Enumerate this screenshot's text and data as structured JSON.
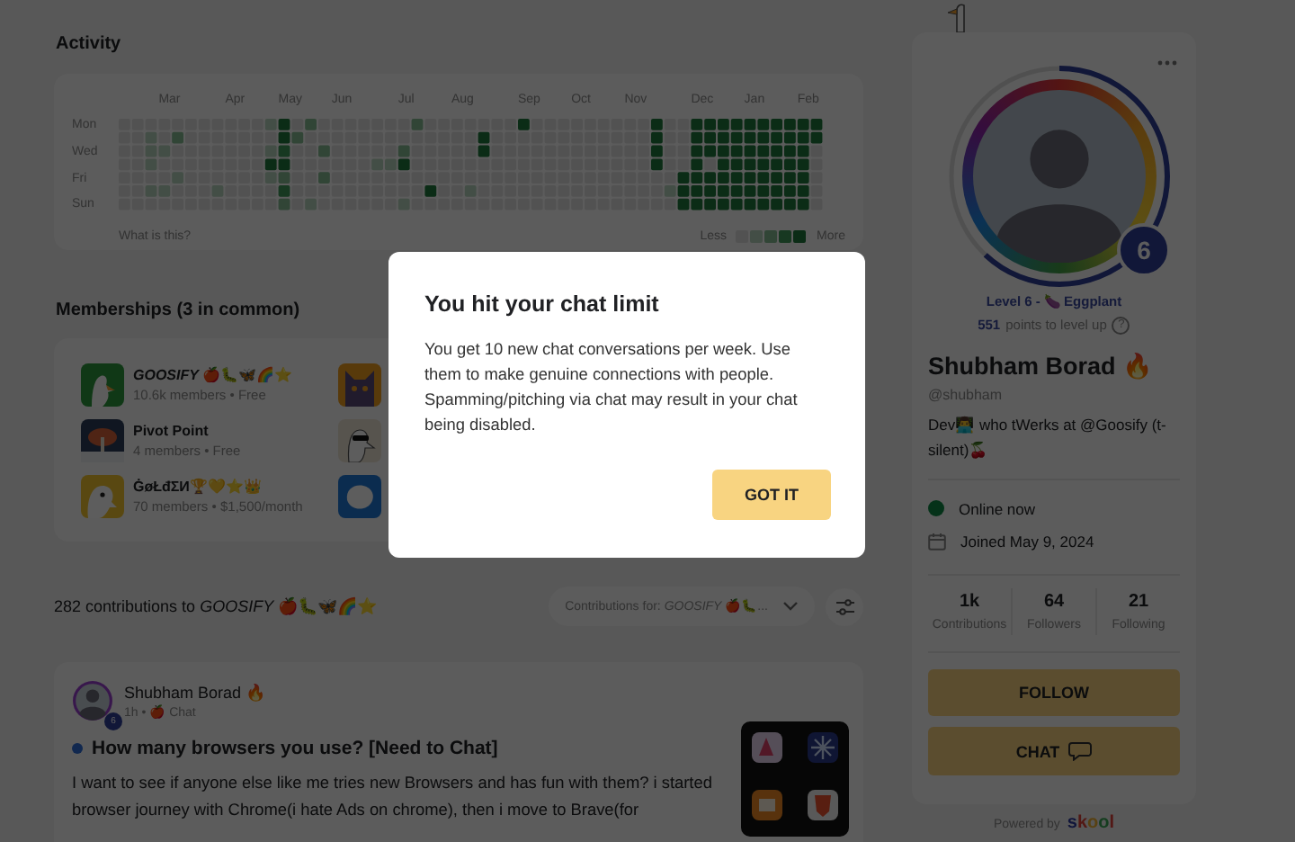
{
  "activity": {
    "title": "Activity",
    "months": [
      "Mar",
      "Apr",
      "May",
      "Jun",
      "Jul",
      "Aug",
      "Sep",
      "Oct",
      "Nov",
      "Dec",
      "Jan",
      "Feb"
    ],
    "day_labels": [
      "Mon",
      "Wed",
      "Fri",
      "Sun"
    ],
    "help_link": "What is this?",
    "legend_less": "Less",
    "legend_more": "More"
  },
  "memberships": {
    "title": "Memberships (3 in common)",
    "items": [
      {
        "name": "*GOOSIFY* 🍎🐛🦋🌈⭐",
        "meta": "10.6k members • Free"
      },
      {
        "name": "Pivot Point",
        "meta": "4 members • Free"
      },
      {
        "name": "ĠøŁđΣИ🏆💛⭐👑",
        "meta": "70 members • $1,500/month"
      }
    ]
  },
  "contributions": {
    "summary": "282 contributions to *GOOSIFY* 🍎🐛🦋🌈⭐",
    "filter": "Contributions for: *GOOSIFY* 🍎🐛..."
  },
  "post": {
    "author": "Shubham Borad 🔥",
    "badge": "6",
    "meta": "1h • 🍎 Chat",
    "unread": true,
    "title": "How many browsers you use? [Need to Chat]",
    "body": "I want to see if anyone else like me tries new Browsers and has fun with them? i started browser journey with Chrome(i hate Ads on chrome), then i move to Brave(for"
  },
  "profile": {
    "badge": "6",
    "progress": {
      "level": 0.62
    },
    "level_name": "Level 6 - 🍆 Eggplant",
    "points": "551",
    "points_text": "points to level up",
    "help": "?",
    "name": "Shubham Borad 🔥",
    "handle": "@shubham",
    "bio": "Dev👨‍💻 who tWerks at @Goosify (t-silent)🍒",
    "online": true,
    "online_text": "Online now",
    "joined": "Joined May 9, 2024",
    "stats": [
      {
        "value": "1k",
        "label": "Contributions"
      },
      {
        "value": "64",
        "label": "Followers"
      },
      {
        "value": "21",
        "label": "Following"
      }
    ],
    "buttons": [
      {
        "label": "FOLLOW",
        "kind": "follow"
      },
      {
        "label": "CHAT",
        "kind": "chat"
      }
    ],
    "powered_by": "Powered by",
    "brand": "skool"
  },
  "modal": {
    "title": "You hit your chat limit",
    "body": "You get 10 new chat conversations per week. Use them to make genuine connections with people. Spamming/pitching via chat may result in your chat being disabled.",
    "button": "GOT IT"
  }
}
